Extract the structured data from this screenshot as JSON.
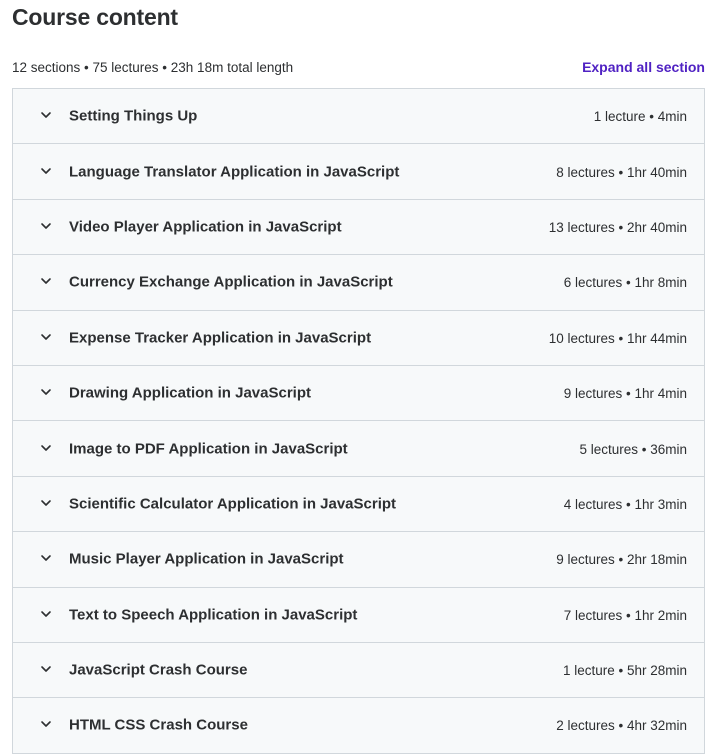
{
  "header": {
    "title": "Course content",
    "summary": "12 sections • 75 lectures • 23h 18m total length",
    "expand_label": "Expand all section"
  },
  "colors": {
    "accent": "#5022c3",
    "section_bg": "#f7f9fa",
    "border": "#d1d7dc",
    "text": "#2d2f31"
  },
  "sections": [
    {
      "title": "Setting Things Up",
      "meta": "1 lecture • 4min"
    },
    {
      "title": "Language Translator Application in JavaScript",
      "meta": "8 lectures • 1hr 40min"
    },
    {
      "title": "Video Player Application in JavaScript",
      "meta": "13 lectures • 2hr 40min"
    },
    {
      "title": "Currency Exchange Application in JavaScript",
      "meta": "6 lectures • 1hr 8min"
    },
    {
      "title": "Expense Tracker Application in JavaScript",
      "meta": "10 lectures • 1hr 44min"
    },
    {
      "title": "Drawing Application in JavaScript",
      "meta": "9 lectures • 1hr 4min"
    },
    {
      "title": "Image to PDF Application in JavaScript",
      "meta": "5 lectures • 36min"
    },
    {
      "title": "Scientific Calculator Application in JavaScript",
      "meta": "4 lectures • 1hr 3min"
    },
    {
      "title": "Music Player Application in JavaScript",
      "meta": "9 lectures • 2hr 18min"
    },
    {
      "title": "Text to Speech Application in JavaScript",
      "meta": "7 lectures • 1hr 2min"
    },
    {
      "title": "JavaScript Crash Course",
      "meta": "1 lecture • 5hr 28min"
    },
    {
      "title": "HTML CSS Crash Course",
      "meta": "2 lectures • 4hr 32min"
    }
  ]
}
